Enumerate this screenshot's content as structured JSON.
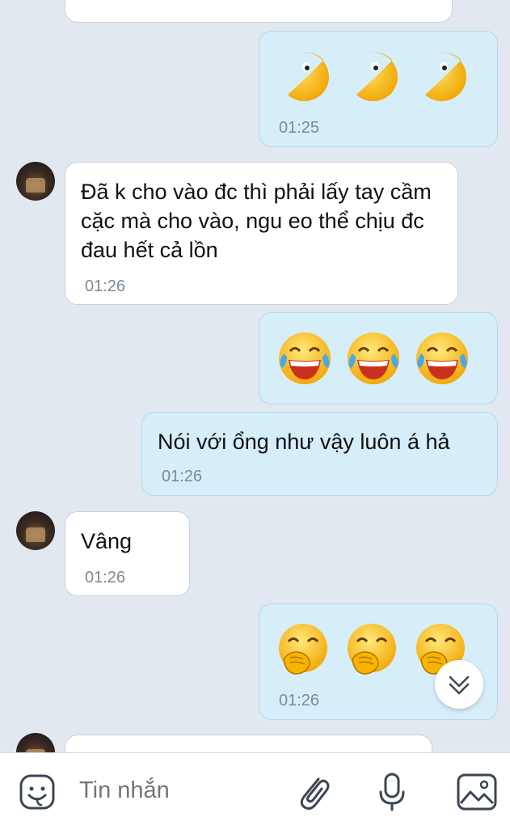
{
  "messages": [
    {
      "id": "m1",
      "direction": "out",
      "type": "emoji",
      "emoji": [
        "pacman-emoji",
        "pacman-emoji",
        "pacman-emoji"
      ],
      "time": "01:25"
    },
    {
      "id": "m2",
      "direction": "in",
      "type": "text",
      "text": "Đã k cho vào đc thì phải lấy tay cầm cặc mà cho vào, ngu eo thể chịu đc đau hết cả lồn",
      "time": "01:26"
    },
    {
      "id": "m3",
      "direction": "out",
      "type": "emoji",
      "emoji": [
        "tears-of-joy-emoji",
        "tears-of-joy-emoji",
        "tears-of-joy-emoji"
      ],
      "time": ""
    },
    {
      "id": "m4",
      "direction": "out",
      "type": "text",
      "text": "Nói với ổng như vậy luôn á hả",
      "time": "01:26"
    },
    {
      "id": "m5",
      "direction": "in",
      "type": "text",
      "text": "Vâng",
      "time": "01:26"
    },
    {
      "id": "m6",
      "direction": "out",
      "type": "emoji",
      "emoji": [
        "giggle-emoji",
        "giggle-emoji",
        "giggle-emoji"
      ],
      "time": "01:26"
    }
  ],
  "input": {
    "placeholder": "Tin nhắn"
  },
  "icons": {
    "sticker": "sticker-icon",
    "attach": "paperclip-icon",
    "voice": "microphone-icon",
    "image": "image-icon",
    "scroll": "chevron-down-double-icon"
  },
  "colors": {
    "outgoing": "#d6eefa",
    "incoming": "#ffffff",
    "background": "#e2e8ef",
    "time": "#7a8a97"
  }
}
